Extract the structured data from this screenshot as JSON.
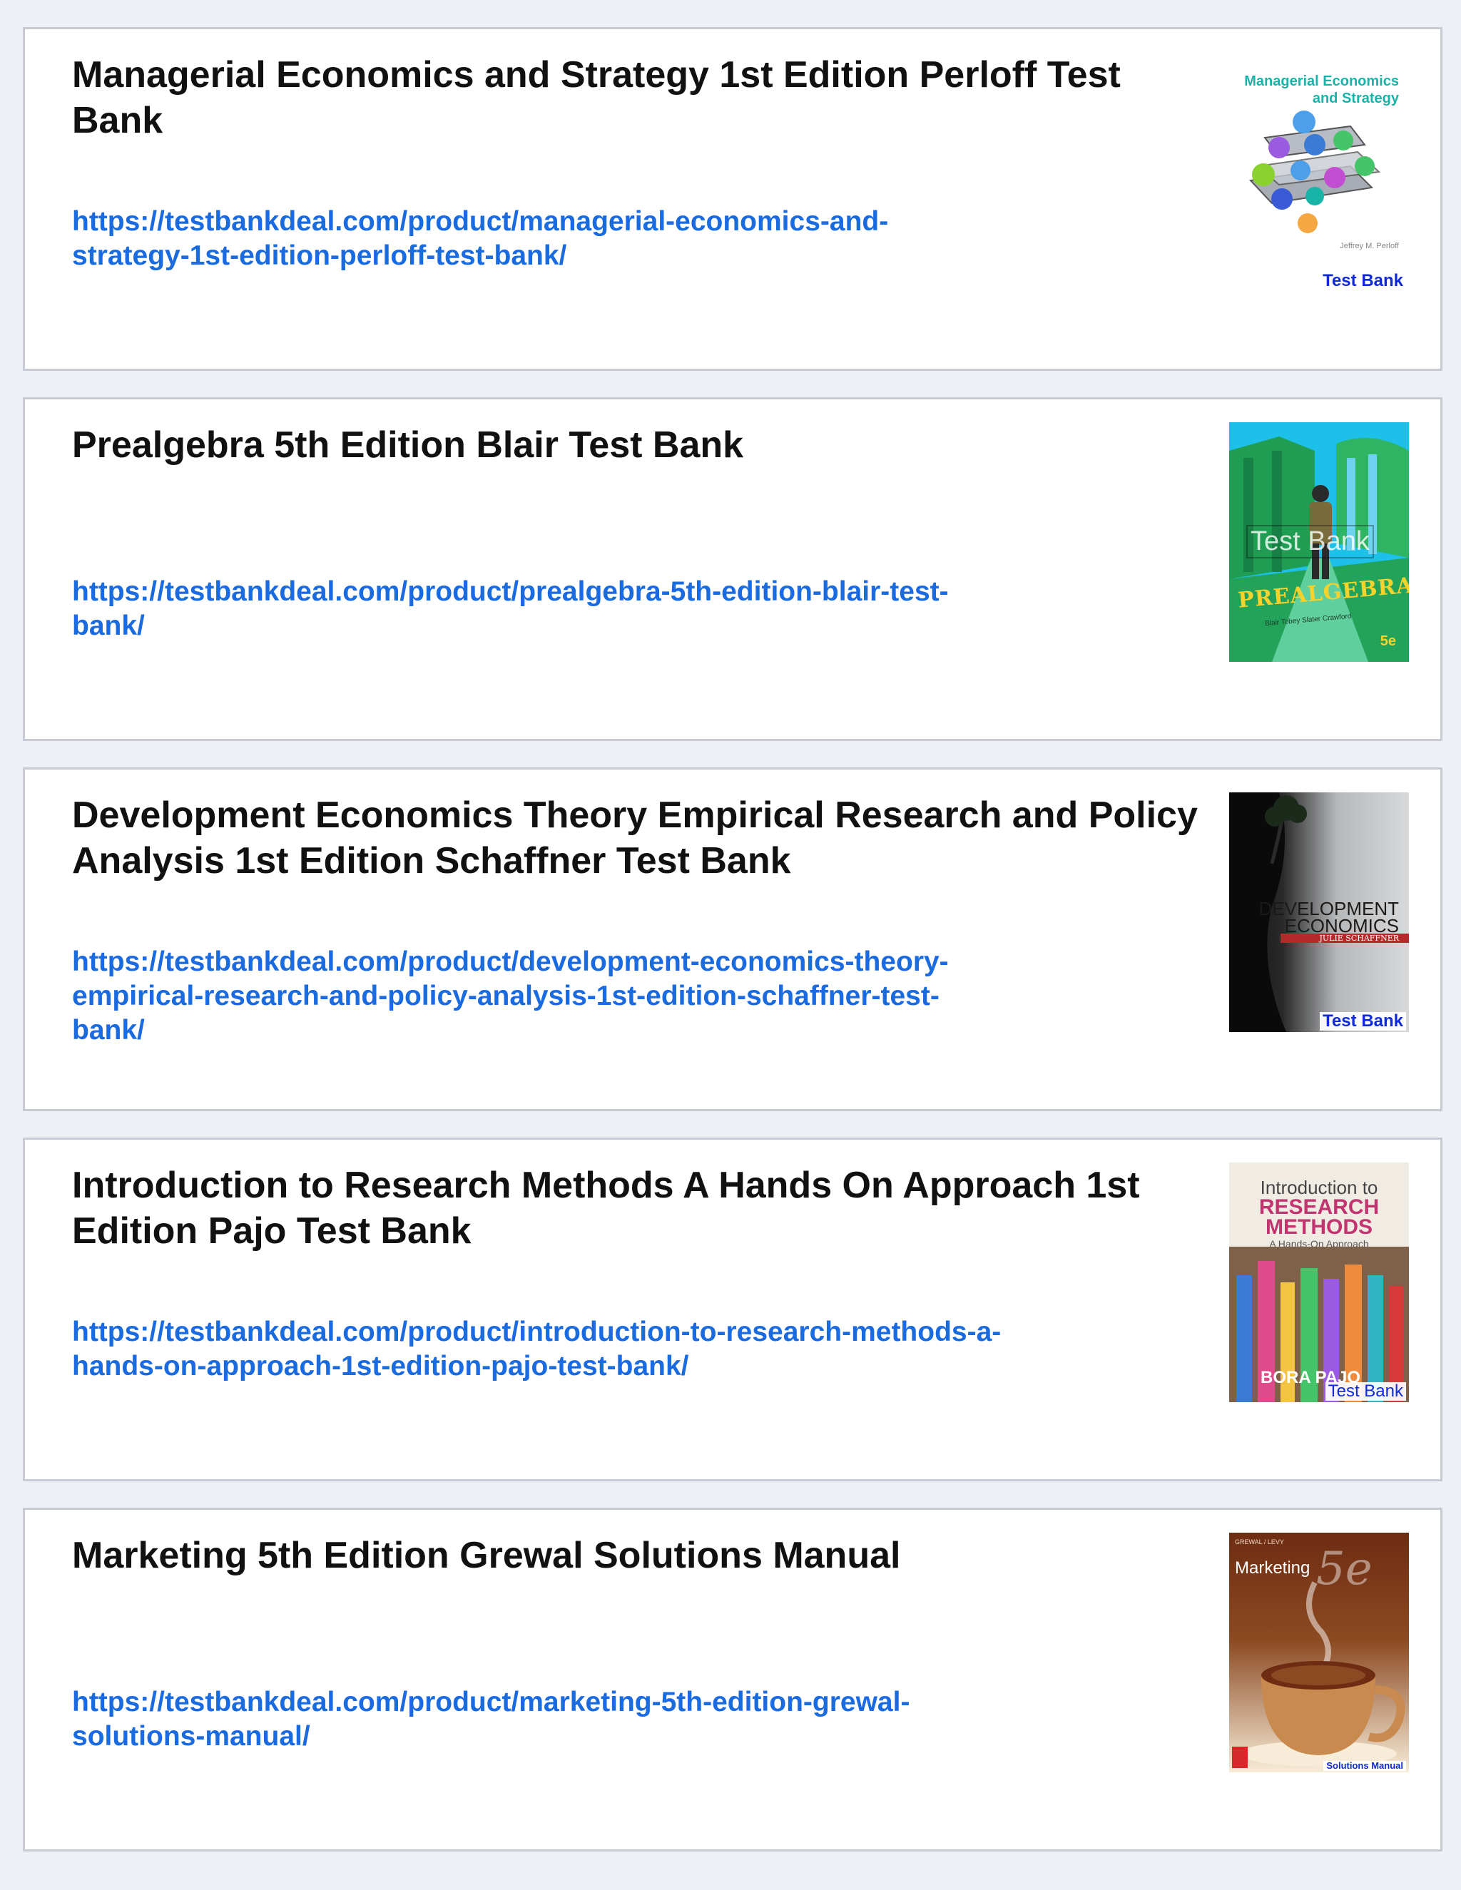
{
  "products": [
    {
      "title": "Managerial Economics and Strategy 1st Edition Perloff Test\nBank",
      "url": "https://testbankdeal.com/product/managerial-economics-and-\nstrategy-1st-edition-perloff-test-bank/",
      "cover": {
        "title_line1": "Managerial Economics",
        "title_line2": "and Strategy",
        "author": "Jeffrey M. Perloff",
        "badge": "Test Bank",
        "colors": [
          "#1ab3a8",
          "#4c9fe8",
          "#9a5be0",
          "#45c46a",
          "#f4a742"
        ]
      }
    },
    {
      "title": "Prealgebra 5th Edition Blair Test Bank",
      "url": "https://testbankdeal.com/product/prealgebra-5th-edition-blair-test-\nbank/",
      "cover": {
        "watermark": "Test Bank",
        "title": "PREALGEBRA",
        "authors": "Blair   Tobey   Slater   Crawford",
        "edition": "5e",
        "colors": [
          "#1cc0e8",
          "#1f9e53",
          "#f6d22d"
        ]
      }
    },
    {
      "title": "Development Economics Theory Empirical Research and Policy\nAnalysis 1st Edition Schaffner Test Bank",
      "url": "https://testbankdeal.com/product/development-economics-theory-\nempirical-research-and-policy-analysis-1st-edition-schaffner-test-\nbank/",
      "cover": {
        "title_line1": "DEVELOPMENT",
        "title_line2": "ECONOMICS",
        "author": "JULIE SCHAFFNER",
        "badge": "Test Bank",
        "colors": [
          "#121212",
          "#c4c6c8",
          "#b42a2a"
        ]
      }
    },
    {
      "title": "Introduction to Research Methods A Hands On Approach 1st\nEdition Pajo Test Bank",
      "url": "https://testbankdeal.com/product/introduction-to-research-methods-a-\nhands-on-approach-1st-edition-pajo-test-bank/",
      "cover": {
        "intro": "Introduction to",
        "line1": "RESEARCH",
        "line2": "METHODS",
        "subtitle": "A Hands-On Approach",
        "author": "BORA PAJO",
        "badge": "Test Bank",
        "colors": [
          "#c2336f",
          "#f0ebe3",
          "#8a6a4e"
        ]
      }
    },
    {
      "title": "Marketing 5th Edition Grewal Solutions Manual",
      "url": "https://testbankdeal.com/product/marketing-5th-edition-grewal-\nsolutions-manual/",
      "cover": {
        "authors": "GREWAL / LEVY",
        "title": "Marketing",
        "edition": "5e",
        "badge": "Solutions Manual",
        "colors": [
          "#6e2c12",
          "#c88a4e",
          "#f7ecd8"
        ]
      }
    }
  ]
}
